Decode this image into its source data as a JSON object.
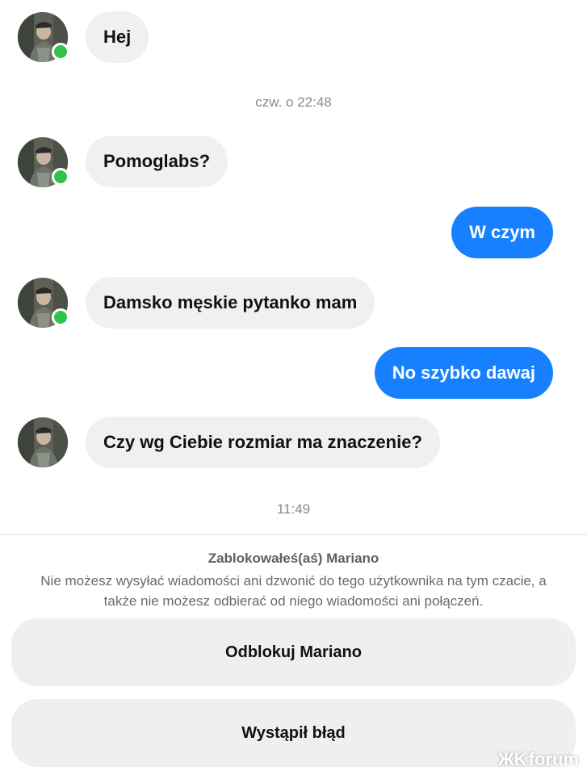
{
  "messages": [
    {
      "text": "Hej"
    },
    {
      "text": "czw. o 22:48"
    },
    {
      "text": "Pomoglabs?"
    },
    {
      "text": "W czym"
    },
    {
      "text": "Damsko męskie pytanko mam"
    },
    {
      "text": "No szybko dawaj"
    },
    {
      "text": "Czy wg Ciebie rozmiar ma znaczenie?"
    },
    {
      "text": "11:49"
    }
  ],
  "blocked": {
    "title": "Zablokowałeś(aś) Mariano",
    "description": "Nie możesz wysyłać wiadomości ani dzwonić do tego użytkownika na tym czacie, a także nie możesz odbierać od niego wiadomości ani połączeń."
  },
  "actions": {
    "unblock_label": "Odblokuj Mariano",
    "error_label": "Wystąpił błąd"
  },
  "watermark": {
    "mark": "ЖK",
    "text": "forum"
  },
  "colors": {
    "outgoing_bubble": "#1780ff",
    "incoming_bubble": "#f0f0f0",
    "online_dot": "#31c24a",
    "timestamp": "#8a8a8a"
  },
  "icons": {
    "avatar": "profile-photo",
    "presence": "online-dot-icon"
  }
}
